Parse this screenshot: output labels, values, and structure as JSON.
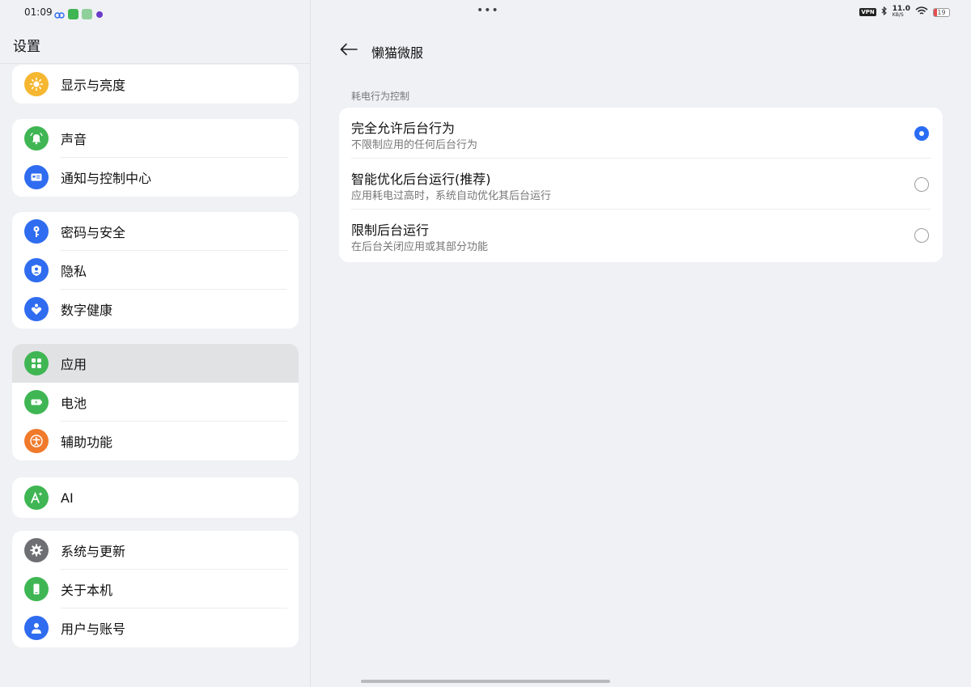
{
  "status": {
    "time": "01:09",
    "vpn": "VPN",
    "net_speed": "11.0",
    "net_unit": "KB/S",
    "battery_level": 19
  },
  "settings": {
    "title": "设置",
    "groups": [
      {
        "items": [
          {
            "label": "显示与亮度",
            "icon": "brightness-icon",
            "color": "#f5b731"
          }
        ]
      },
      {
        "items": [
          {
            "label": "声音",
            "icon": "bell-icon",
            "color": "#3fb653"
          },
          {
            "label": "通知与控制中心",
            "icon": "notification-card-icon",
            "color": "#2f6cf0"
          }
        ]
      },
      {
        "items": [
          {
            "label": "密码与安全",
            "icon": "key-icon",
            "color": "#2f6cf0"
          },
          {
            "label": "隐私",
            "icon": "privacy-shield-icon",
            "color": "#2f6cf0"
          },
          {
            "label": "数字健康",
            "icon": "digital-wellbeing-icon",
            "color": "#2f6cf0"
          }
        ]
      },
      {
        "items": [
          {
            "label": "应用",
            "icon": "apps-grid-icon",
            "color": "#3fb653"
          },
          {
            "label": "电池",
            "icon": "battery-icon",
            "color": "#3fb653"
          },
          {
            "label": "辅助功能",
            "icon": "accessibility-icon",
            "color": "#f07a2b"
          }
        ]
      },
      {
        "items": [
          {
            "label": "AI",
            "icon": "ai-sparkle-icon",
            "color": "#3fb653"
          }
        ]
      },
      {
        "items": [
          {
            "label": "系统与更新",
            "icon": "gear-icon",
            "color": "#6e6f73"
          },
          {
            "label": "关于本机",
            "icon": "phone-icon",
            "color": "#3fb653"
          },
          {
            "label": "用户与账号",
            "icon": "user-icon",
            "color": "#2f6cf0"
          }
        ]
      }
    ]
  },
  "detail": {
    "title": "懒猫微服",
    "section_label": "耗电行为控制",
    "options": [
      {
        "title": "完全允许后台行为",
        "desc": "不限制应用的任何后台行为",
        "selected": true
      },
      {
        "title": "智能优化后台运行(推荐)",
        "desc": "应用耗电过高时，系统自动优化其后台运行",
        "selected": false
      },
      {
        "title": "限制后台运行",
        "desc": "在后台关闭应用或其部分功能",
        "selected": false
      }
    ]
  }
}
